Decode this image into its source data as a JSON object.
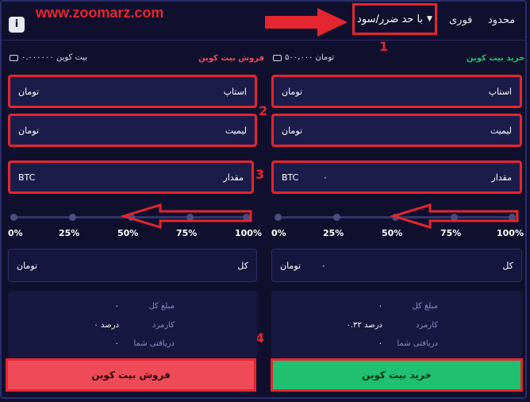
{
  "watermark": "www.zoomarz.com",
  "header": {
    "info": "i",
    "tabs": {
      "limit": "محدود",
      "instant": "فوری",
      "stop": "با حد ضرر/سود"
    }
  },
  "annotations": {
    "n1": "1",
    "n2": "2",
    "n3": "3",
    "n4": "4"
  },
  "sell": {
    "title": "فروش بیت کوین",
    "balance": "۰.۰۰۰۰۰۰ بیت کوین",
    "stop_label": "استاپ",
    "stop_unit": "تومان",
    "limit_label": "لیمیت",
    "limit_unit": "تومان",
    "amount_label": "مقدار",
    "amount_unit": "BTC",
    "total_label": "کل",
    "total_unit": "تومان",
    "summary": {
      "total_label": "مبلغ کل",
      "total_value": "۰",
      "fee_label": "کارمزد",
      "fee_value": "۰ درصد",
      "receive_label": "دریافتی شما",
      "receive_value": "۰"
    },
    "button": "فروش بیت کوین"
  },
  "buy": {
    "title": "خرید بیت کوین",
    "balance": "۵۰۰،۰۰۰ تومان",
    "stop_label": "استاپ",
    "stop_unit": "تومان",
    "limit_label": "لیمیت",
    "limit_unit": "تومان",
    "amount_label": "مقدار",
    "amount_unit": "BTC",
    "amount_value": "۰",
    "total_label": "کل",
    "total_unit": "تومان",
    "total_value": "۰",
    "summary": {
      "total_label": "مبلغ کل",
      "total_value": "۰",
      "fee_label": "کارمزد",
      "fee_value": "۰.۳۲ درصد",
      "receive_label": "دریافتی شما",
      "receive_value": "۰"
    },
    "button": "خرید بیت کوین"
  },
  "slider_marks": [
    "0%",
    "25%",
    "50%",
    "75%",
    "100%"
  ],
  "colors": {
    "accent_red": "#e3262f",
    "sell": "#ef4a58",
    "buy": "#1fc06f",
    "bg": "#10102e"
  }
}
